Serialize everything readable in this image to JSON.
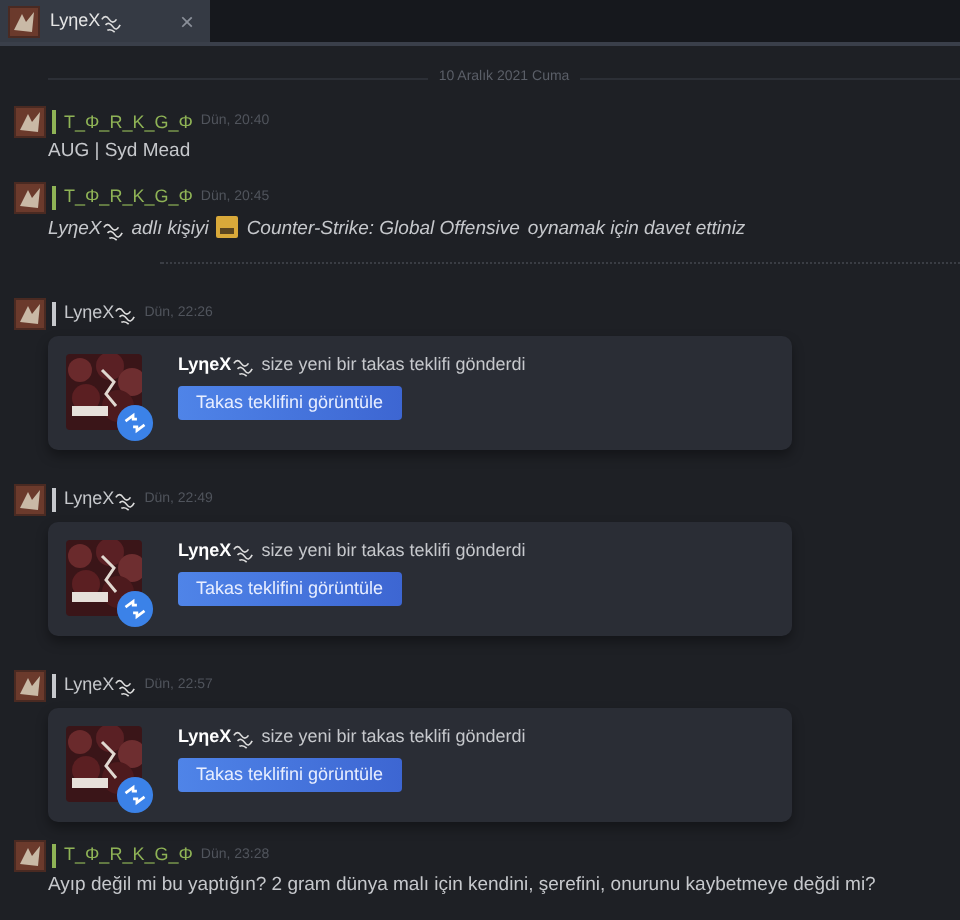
{
  "tab": {
    "title": "LyηeX",
    "squiggle": true,
    "close": "×"
  },
  "date_divider": "10 Aralık 2021 Cuma",
  "messages": [
    {
      "kind": "text",
      "author": "T_Φ_R_K_G_Φ",
      "squiggle": false,
      "color": "#8fb356",
      "time": "Dün, 20:40",
      "text": "AUG | Syd Mead"
    },
    {
      "kind": "invite",
      "author": "T_Φ_R_K_G_Φ",
      "squiggle": false,
      "color": "#8fb356",
      "time": "Dün, 20:45",
      "invitee": "LyηeX",
      "text_before": "adlı kişiyi",
      "game": "Counter-Strike: Global Offensive",
      "text_after": "oynamak için davet ettiniz"
    },
    {
      "kind": "trade",
      "author": "LyηeX",
      "squiggle": true,
      "color": "#c6c8cc",
      "time": "Dün, 22:26",
      "sender": "LyηeX",
      "text": "size yeni bir takas teklifi gönderdi",
      "button": "Takas teklifini görüntüle"
    },
    {
      "kind": "trade",
      "author": "LyηeX",
      "squiggle": true,
      "color": "#c6c8cc",
      "time": "Dün, 22:49",
      "sender": "LyηeX",
      "text": "size yeni bir takas teklifi gönderdi",
      "button": "Takas teklifini görüntüle"
    },
    {
      "kind": "trade",
      "author": "LyηeX",
      "squiggle": true,
      "color": "#c6c8cc",
      "time": "Dün, 22:57",
      "sender": "LyηeX",
      "text": "size yeni bir takas teklifi gönderdi",
      "button": "Takas teklifini görüntüle"
    },
    {
      "kind": "text",
      "author": "T_Φ_R_K_G_Φ",
      "squiggle": false,
      "color": "#8fb356",
      "time": "Dün, 23:28",
      "text": "Ayıp değil mi bu yaptığın? 2 gram dünya malı için kendini, şerefini, onurunu kaybetmeye değdi mi?"
    }
  ]
}
